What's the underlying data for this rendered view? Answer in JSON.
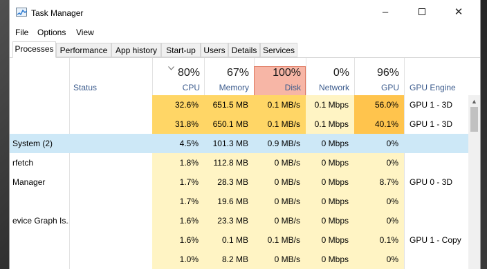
{
  "window": {
    "title": "Task Manager",
    "min_symbol": "–",
    "close_symbol": "✕"
  },
  "menu": [
    "File",
    "Options",
    "View"
  ],
  "tabs": [
    "Processes",
    "Performance",
    "App history",
    "Start-up",
    "Users",
    "Details",
    "Services"
  ],
  "columns": {
    "status": "Status",
    "cpu": {
      "pct": "80%",
      "label": "CPU"
    },
    "memory": {
      "pct": "67%",
      "label": "Memory"
    },
    "disk": {
      "pct": "100%",
      "label": "Disk"
    },
    "network": {
      "pct": "0%",
      "label": "Network"
    },
    "gpu": {
      "pct": "96%",
      "label": "GPU"
    },
    "gpu_engine": "GPU Engine"
  },
  "rows": [
    {
      "name": "",
      "cpu": "32.6%",
      "memory": "651.5 MB",
      "disk": "0.1 MB/s",
      "network": "0.1 Mbps",
      "gpu": "56.0%",
      "gpu_engine": "GPU 1 - 3D"
    },
    {
      "name": "",
      "cpu": "31.8%",
      "memory": "650.1 MB",
      "disk": "0.1 MB/s",
      "network": "0.1 Mbps",
      "gpu": "40.1%",
      "gpu_engine": "GPU 1 - 3D"
    },
    {
      "name": "System (2)",
      "cpu": "4.5%",
      "memory": "101.3 MB",
      "disk": "0.9 MB/s",
      "network": "0 Mbps",
      "gpu": "0%",
      "gpu_engine": ""
    },
    {
      "name": "rfetch",
      "cpu": "1.8%",
      "memory": "112.8 MB",
      "disk": "0 MB/s",
      "network": "0 Mbps",
      "gpu": "0%",
      "gpu_engine": ""
    },
    {
      "name": "Manager",
      "cpu": "1.7%",
      "memory": "28.3 MB",
      "disk": "0 MB/s",
      "network": "0 Mbps",
      "gpu": "8.7%",
      "gpu_engine": "GPU 0 - 3D"
    },
    {
      "name": "",
      "cpu": "1.7%",
      "memory": "19.6 MB",
      "disk": "0 MB/s",
      "network": "0 Mbps",
      "gpu": "0%",
      "gpu_engine": ""
    },
    {
      "name": "evice Graph Is...",
      "cpu": "1.6%",
      "memory": "23.3 MB",
      "disk": "0 MB/s",
      "network": "0 Mbps",
      "gpu": "0%",
      "gpu_engine": ""
    },
    {
      "name": "",
      "cpu": "1.6%",
      "memory": "0.1 MB",
      "disk": "0.1 MB/s",
      "network": "0 Mbps",
      "gpu": "0.1%",
      "gpu_engine": "GPU 1 - Copy"
    },
    {
      "name": "",
      "cpu": "1.0%",
      "memory": "8.2 MB",
      "disk": "0 MB/s",
      "network": "0 Mbps",
      "gpu": "0%",
      "gpu_engine": ""
    }
  ]
}
